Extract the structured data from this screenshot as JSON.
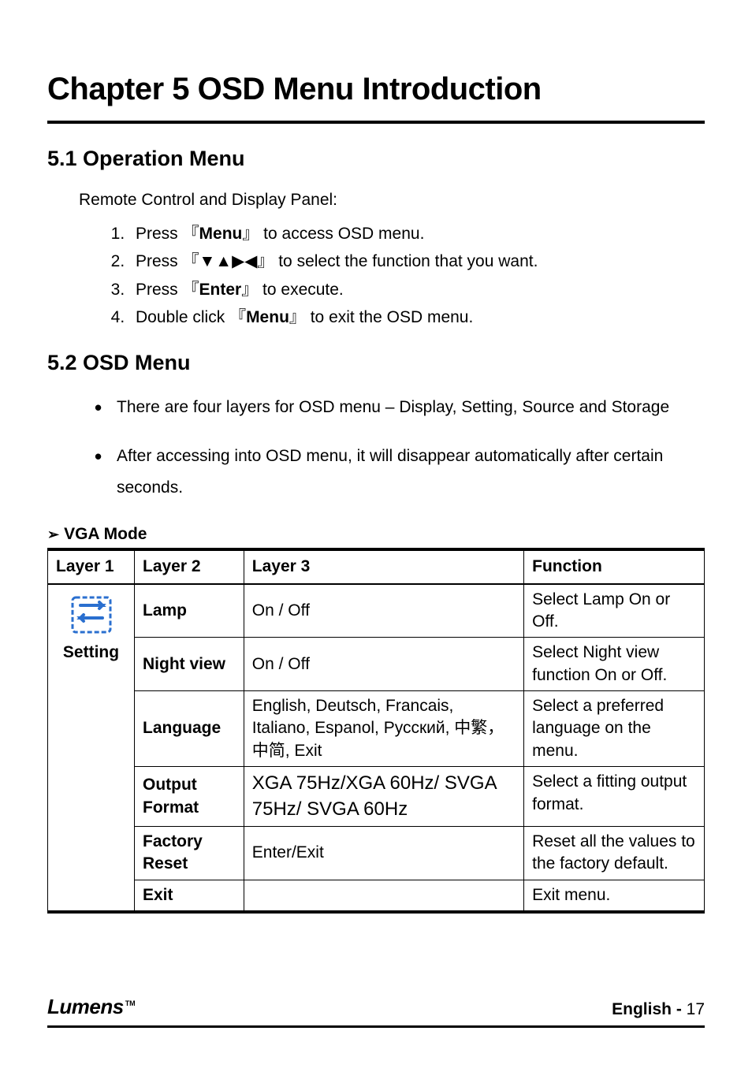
{
  "chapter": {
    "title": "Chapter 5 OSD Menu Introduction"
  },
  "section_5_1": {
    "header": "5.1 Operation Menu",
    "intro": "Remote Control and Display Panel:",
    "steps": {
      "s1_a": "Press ",
      "s1_b": "Menu",
      "s1_c": " to access OSD menu.",
      "s2_a": "Press ",
      "s2_b": " to select the function that you want.",
      "s3_a": "Press ",
      "s3_b": "Enter",
      "s3_c": " to execute.",
      "s4_a": "Double click ",
      "s4_b": "Menu",
      "s4_c": " to exit the OSD menu."
    }
  },
  "section_5_2": {
    "header": "5.2 OSD Menu",
    "bullets": {
      "b1": "There are four layers for OSD menu – Display, Setting, Source and Storage",
      "b2": "After accessing into OSD menu, it will disappear automatically after certain seconds."
    }
  },
  "mode_heading": "VGA Mode",
  "table": {
    "headers": {
      "h1": "Layer 1",
      "h2": "Layer 2",
      "h3": "Layer 3",
      "h4": "Function"
    },
    "layer1_label": "Setting",
    "rows": {
      "lamp": {
        "l2": "Lamp",
        "l3": "On / Off",
        "fn": "Select Lamp On or Off."
      },
      "night_view": {
        "l2": "Night view",
        "l3": "On / Off",
        "fn": "Select Night view function On or Off."
      },
      "language": {
        "l2": "Language",
        "l3": "English, Deutsch, Francais, Italiano, Espanol, Русский, 中繁，中简, Exit",
        "fn": "Select a preferred language on the menu."
      },
      "output_fmt": {
        "l2": "Output Format",
        "l3": "XGA 75Hz/XGA 60Hz/ SVGA 75Hz/ SVGA 60Hz",
        "fn": "Select a fitting output format."
      },
      "factory": {
        "l2": "Factory Reset",
        "l3": "Enter/Exit",
        "fn": "Reset all the values to the factory default."
      },
      "exit": {
        "l2": "Exit",
        "l3": "",
        "fn": "Exit menu."
      }
    }
  },
  "footer": {
    "logo": "Lumens",
    "lang_label": "English - ",
    "page_number": "17"
  }
}
